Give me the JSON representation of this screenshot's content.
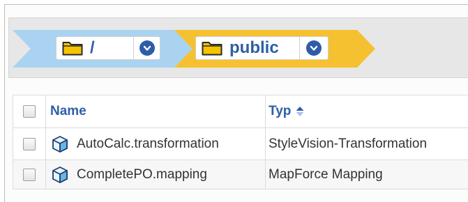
{
  "breadcrumb": {
    "items": [
      {
        "label": "/",
        "icon": "folder-icon",
        "dropdown_icon": "chevron-down-circle-icon",
        "color": "#a9d3f0"
      },
      {
        "label": "public",
        "icon": "folder-icon",
        "dropdown_icon": "chevron-down-circle-icon",
        "color": "#f5c130"
      }
    ]
  },
  "table": {
    "columns": [
      {
        "label": "Name"
      },
      {
        "label": "Typ",
        "sort_icon": "sort-ascending-icon"
      }
    ],
    "rows": [
      {
        "name": "AutoCalc.transformation",
        "type": "StyleVision-Transformation",
        "icon": "cube-icon"
      },
      {
        "name": "CompletePO.mapping",
        "type": "MapForce Mapping",
        "icon": "cube-icon"
      }
    ]
  },
  "colors": {
    "accent": "#2e5fa8",
    "crumb_root": "#a9d3f0",
    "crumb_active": "#f5c130",
    "folder": "#f2c200"
  }
}
